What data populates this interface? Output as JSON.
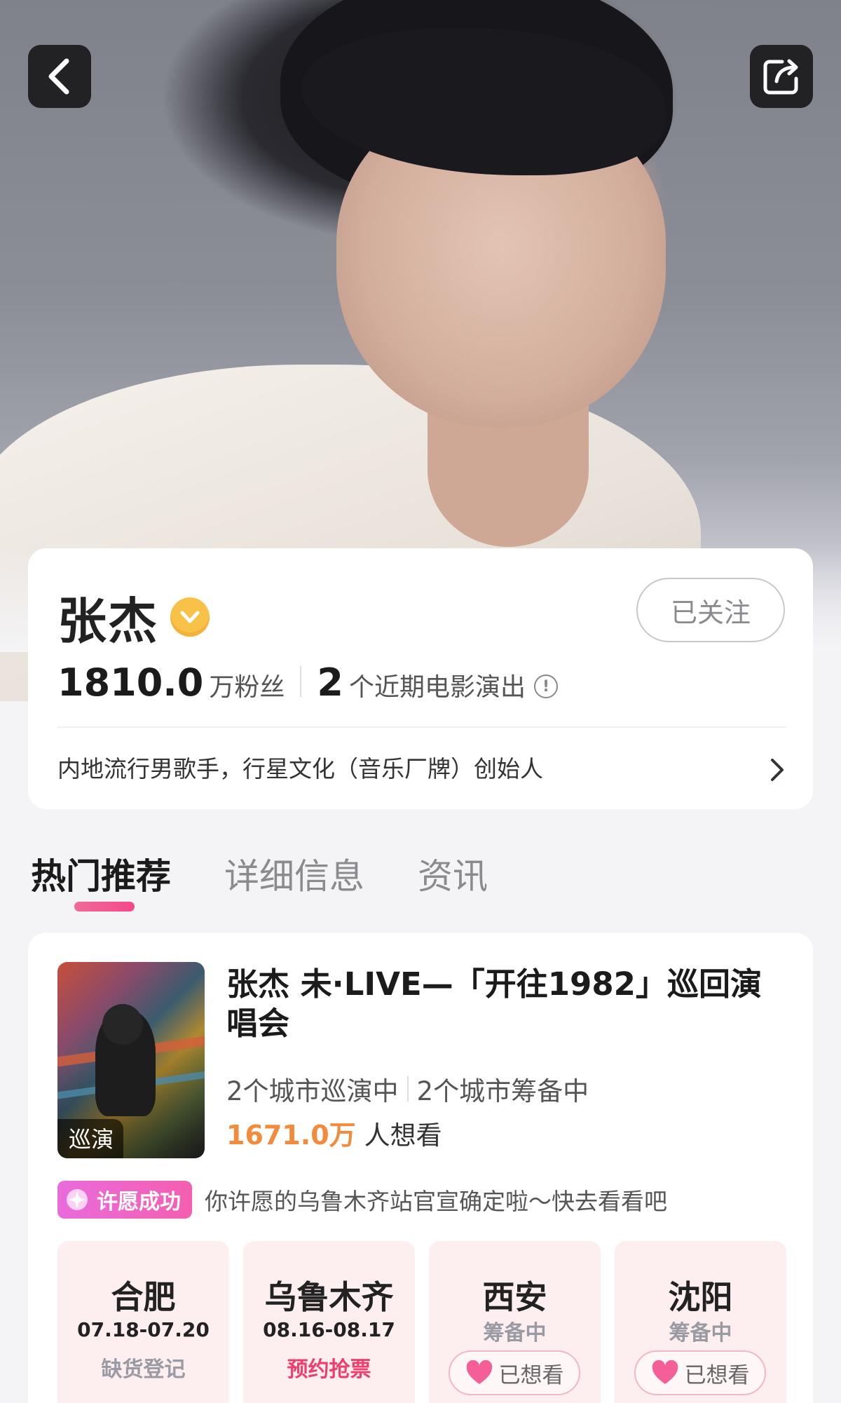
{
  "header": {
    "back_icon": "back-icon",
    "share_icon": "share-icon"
  },
  "artist": {
    "name": "张杰",
    "verified_icon": "verified-badge-icon",
    "follow_label": "已关注",
    "fans_count": "1810.0",
    "fans_unit": "万粉丝",
    "shows_count": "2",
    "shows_unit": "个近期电影演出",
    "info_glyph": "!",
    "bio": "内地流行男歌手，行星文化（音乐厂牌）创始人"
  },
  "tabs": [
    {
      "label": "热门推荐",
      "active": true
    },
    {
      "label": "详细信息",
      "active": false
    },
    {
      "label": "资讯",
      "active": false
    }
  ],
  "tour": {
    "poster_tag": "巡演",
    "title": "张杰 未·LIVE—「开往1982」巡回演唱会",
    "touring": "2个城市巡演中",
    "preparing": "2个城市筹备中",
    "want_count": "1671.0万",
    "want_suffix": "人想看",
    "wish_badge": "许愿成功",
    "wish_text": "你许愿的乌鲁木齐站官宣确定啦～快去看看吧",
    "cities": [
      {
        "name": "合肥",
        "date": "07.18-07.20",
        "status": "缺货登记"
      },
      {
        "name": "乌鲁木齐",
        "date": "08.16-08.17",
        "status": "预约抢票"
      },
      {
        "name": "西安",
        "status": "筹备中",
        "wanted": "已想看"
      },
      {
        "name": "沈阳",
        "status": "筹备中",
        "wanted": "已想看"
      }
    ]
  },
  "colors": {
    "accent_pink": "#f4488a",
    "want_orange": "#f28c3c",
    "verified_gold": "#f8c248",
    "status_pink": "#ee3f6c",
    "city_bg": "#fdeef0"
  }
}
